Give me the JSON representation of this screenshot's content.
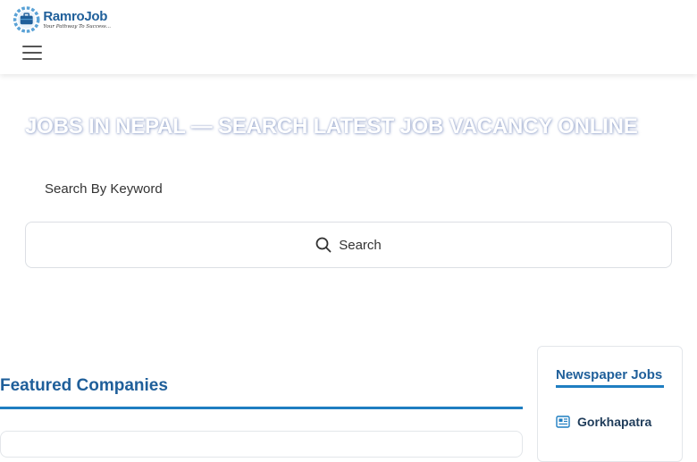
{
  "brand": {
    "name": "RamroJob",
    "tagline": "Your Pathway To Success...",
    "color": "#1f5f9a"
  },
  "nav": {
    "menu_icon": "hamburger-menu-icon"
  },
  "hero": {
    "title_main": "Jobs in Nepal — ",
    "title_accent": "Search Latest Job Vacancy Online"
  },
  "search": {
    "label": "Search By Keyword",
    "button_label": "Search",
    "button_icon": "search-icon"
  },
  "featured": {
    "title": "Featured Companies",
    "accent_color": "#1f7ec1"
  },
  "sidebar": {
    "title": "Newspaper Jobs",
    "items": [
      {
        "label": "Gorkhapatra",
        "icon": "newspaper-icon"
      }
    ]
  }
}
